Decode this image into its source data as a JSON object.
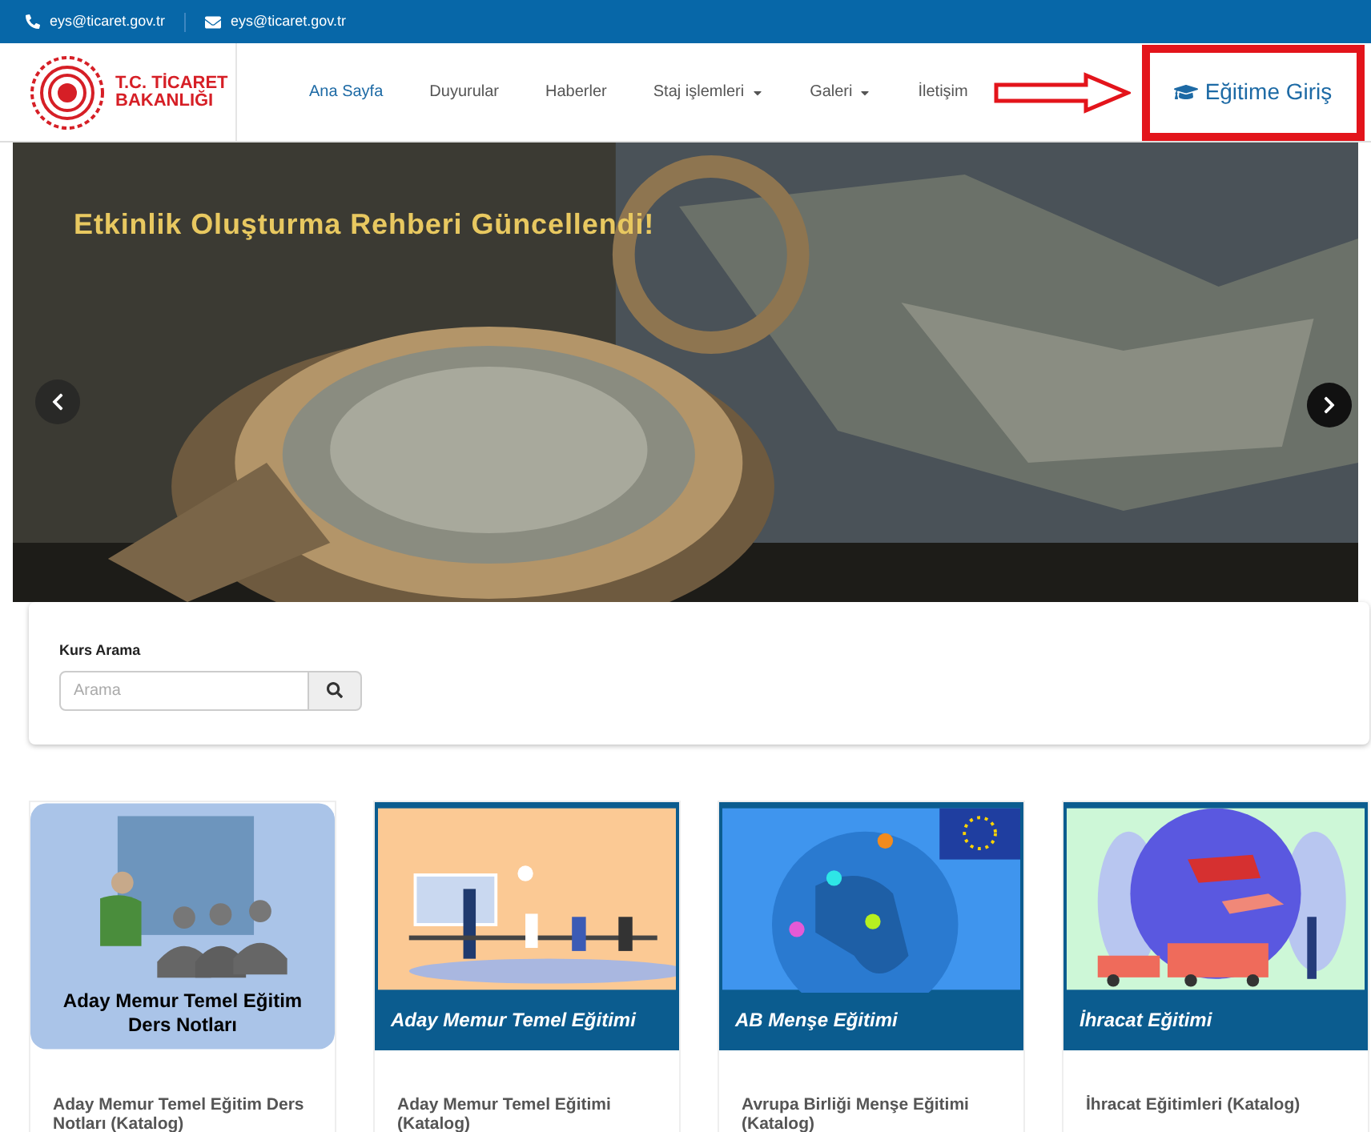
{
  "top_bar": {
    "phone": "eys@ticaret.gov.tr",
    "email": "eys@ticaret.gov.tr"
  },
  "logo": {
    "line1": "T.C. TİCARET",
    "line2": "BAKANLIĞI"
  },
  "nav": [
    {
      "label": "Ana Sayfa",
      "selected": true,
      "dropdown": false
    },
    {
      "label": "Duyurular",
      "selected": false,
      "dropdown": false
    },
    {
      "label": "Haberler",
      "selected": false,
      "dropdown": false
    },
    {
      "label": "Staj işlemleri",
      "selected": false,
      "dropdown": true
    },
    {
      "label": "Galeri",
      "selected": false,
      "dropdown": true
    },
    {
      "label": "İletişim",
      "selected": false,
      "dropdown": false
    }
  ],
  "login_button": {
    "label": "Eğitime Giriş",
    "highlighted": true
  },
  "slider": {
    "title": "Etkinlik Oluşturma Rehberi Güncellendi!"
  },
  "search": {
    "label": "Kurs Arama",
    "placeholder": "Arama"
  },
  "courses": [
    {
      "kind": "presentation",
      "banner": "Aday Memur Temel Eğitim Ders Notları",
      "title": "Aday Memur Temel Eğitim Ders Notları (Katalog)"
    },
    {
      "kind": "classroom",
      "banner": "Aday Memur Temel Eğitimi",
      "title": "Aday Memur Temel Eğitimi (Katalog)"
    },
    {
      "kind": "globe",
      "banner": "AB Menşe Eğitimi",
      "title": "Avrupa Birliği Menşe Eğitimi (Katalog)"
    },
    {
      "kind": "export",
      "banner": "İhracat Eğitimi",
      "title": "İhracat Eğitimleri (Katalog)"
    }
  ]
}
